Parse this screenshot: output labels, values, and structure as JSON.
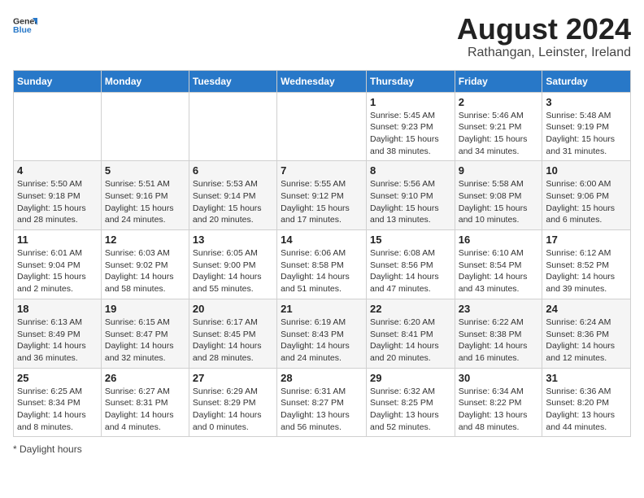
{
  "logo": {
    "text_general": "General",
    "text_blue": "Blue"
  },
  "title": "August 2024",
  "subtitle": "Rathangan, Leinster, Ireland",
  "days_of_week": [
    "Sunday",
    "Monday",
    "Tuesday",
    "Wednesday",
    "Thursday",
    "Friday",
    "Saturday"
  ],
  "weeks": [
    [
      {
        "day": "",
        "info": ""
      },
      {
        "day": "",
        "info": ""
      },
      {
        "day": "",
        "info": ""
      },
      {
        "day": "",
        "info": ""
      },
      {
        "day": "1",
        "info": "Sunrise: 5:45 AM\nSunset: 9:23 PM\nDaylight: 15 hours and 38 minutes."
      },
      {
        "day": "2",
        "info": "Sunrise: 5:46 AM\nSunset: 9:21 PM\nDaylight: 15 hours and 34 minutes."
      },
      {
        "day": "3",
        "info": "Sunrise: 5:48 AM\nSunset: 9:19 PM\nDaylight: 15 hours and 31 minutes."
      }
    ],
    [
      {
        "day": "4",
        "info": "Sunrise: 5:50 AM\nSunset: 9:18 PM\nDaylight: 15 hours and 28 minutes."
      },
      {
        "day": "5",
        "info": "Sunrise: 5:51 AM\nSunset: 9:16 PM\nDaylight: 15 hours and 24 minutes."
      },
      {
        "day": "6",
        "info": "Sunrise: 5:53 AM\nSunset: 9:14 PM\nDaylight: 15 hours and 20 minutes."
      },
      {
        "day": "7",
        "info": "Sunrise: 5:55 AM\nSunset: 9:12 PM\nDaylight: 15 hours and 17 minutes."
      },
      {
        "day": "8",
        "info": "Sunrise: 5:56 AM\nSunset: 9:10 PM\nDaylight: 15 hours and 13 minutes."
      },
      {
        "day": "9",
        "info": "Sunrise: 5:58 AM\nSunset: 9:08 PM\nDaylight: 15 hours and 10 minutes."
      },
      {
        "day": "10",
        "info": "Sunrise: 6:00 AM\nSunset: 9:06 PM\nDaylight: 15 hours and 6 minutes."
      }
    ],
    [
      {
        "day": "11",
        "info": "Sunrise: 6:01 AM\nSunset: 9:04 PM\nDaylight: 15 hours and 2 minutes."
      },
      {
        "day": "12",
        "info": "Sunrise: 6:03 AM\nSunset: 9:02 PM\nDaylight: 14 hours and 58 minutes."
      },
      {
        "day": "13",
        "info": "Sunrise: 6:05 AM\nSunset: 9:00 PM\nDaylight: 14 hours and 55 minutes."
      },
      {
        "day": "14",
        "info": "Sunrise: 6:06 AM\nSunset: 8:58 PM\nDaylight: 14 hours and 51 minutes."
      },
      {
        "day": "15",
        "info": "Sunrise: 6:08 AM\nSunset: 8:56 PM\nDaylight: 14 hours and 47 minutes."
      },
      {
        "day": "16",
        "info": "Sunrise: 6:10 AM\nSunset: 8:54 PM\nDaylight: 14 hours and 43 minutes."
      },
      {
        "day": "17",
        "info": "Sunrise: 6:12 AM\nSunset: 8:52 PM\nDaylight: 14 hours and 39 minutes."
      }
    ],
    [
      {
        "day": "18",
        "info": "Sunrise: 6:13 AM\nSunset: 8:49 PM\nDaylight: 14 hours and 36 minutes."
      },
      {
        "day": "19",
        "info": "Sunrise: 6:15 AM\nSunset: 8:47 PM\nDaylight: 14 hours and 32 minutes."
      },
      {
        "day": "20",
        "info": "Sunrise: 6:17 AM\nSunset: 8:45 PM\nDaylight: 14 hours and 28 minutes."
      },
      {
        "day": "21",
        "info": "Sunrise: 6:19 AM\nSunset: 8:43 PM\nDaylight: 14 hours and 24 minutes."
      },
      {
        "day": "22",
        "info": "Sunrise: 6:20 AM\nSunset: 8:41 PM\nDaylight: 14 hours and 20 minutes."
      },
      {
        "day": "23",
        "info": "Sunrise: 6:22 AM\nSunset: 8:38 PM\nDaylight: 14 hours and 16 minutes."
      },
      {
        "day": "24",
        "info": "Sunrise: 6:24 AM\nSunset: 8:36 PM\nDaylight: 14 hours and 12 minutes."
      }
    ],
    [
      {
        "day": "25",
        "info": "Sunrise: 6:25 AM\nSunset: 8:34 PM\nDaylight: 14 hours and 8 minutes."
      },
      {
        "day": "26",
        "info": "Sunrise: 6:27 AM\nSunset: 8:31 PM\nDaylight: 14 hours and 4 minutes."
      },
      {
        "day": "27",
        "info": "Sunrise: 6:29 AM\nSunset: 8:29 PM\nDaylight: 14 hours and 0 minutes."
      },
      {
        "day": "28",
        "info": "Sunrise: 6:31 AM\nSunset: 8:27 PM\nDaylight: 13 hours and 56 minutes."
      },
      {
        "day": "29",
        "info": "Sunrise: 6:32 AM\nSunset: 8:25 PM\nDaylight: 13 hours and 52 minutes."
      },
      {
        "day": "30",
        "info": "Sunrise: 6:34 AM\nSunset: 8:22 PM\nDaylight: 13 hours and 48 minutes."
      },
      {
        "day": "31",
        "info": "Sunrise: 6:36 AM\nSunset: 8:20 PM\nDaylight: 13 hours and 44 minutes."
      }
    ]
  ],
  "footer": "Daylight hours"
}
